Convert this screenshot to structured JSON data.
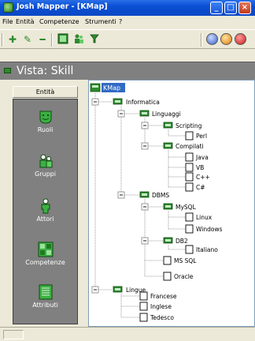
{
  "window": {
    "title": "Josh Mapper - [KMap]"
  },
  "menu": [
    "File",
    "Entità",
    "Competenze",
    "Strumenti",
    "?"
  ],
  "view": {
    "title": "Vista: Skill"
  },
  "entity_panel": {
    "header": "Entità",
    "items": [
      {
        "label": "Ruoli",
        "icon": "face-icon"
      },
      {
        "label": "Gruppi",
        "icon": "group-icon"
      },
      {
        "label": "Attori",
        "icon": "person-icon"
      },
      {
        "label": "Competenze",
        "icon": "grid-icon"
      },
      {
        "label": "Attributi",
        "icon": "list-icon"
      }
    ]
  },
  "tree": {
    "root": "KMap",
    "nodes": {
      "informatica": "Informatica",
      "linguaggi": "Linguaggi",
      "scripting": "Scripting",
      "perl": "Perl",
      "compilati": "Compilati",
      "java": "Java",
      "vb": "VB",
      "cpp": "C++",
      "csharp": "C#",
      "dbms": "DBMS",
      "mysql": "MySQL",
      "linux": "Linux",
      "windows": "Windows",
      "db2": "DB2",
      "italiano": "Italiano",
      "mssql": "MS SQL",
      "oracle": "Oracle",
      "lingue": "Lingue",
      "francese": "Francese",
      "inglese": "Inglese",
      "tedesco": "Tedesco"
    }
  },
  "colors": {
    "titlebar": "#0a4fd4",
    "view_bar": "#808080",
    "entity_panel": "#808080",
    "folder_green": "#2e8b2e"
  }
}
